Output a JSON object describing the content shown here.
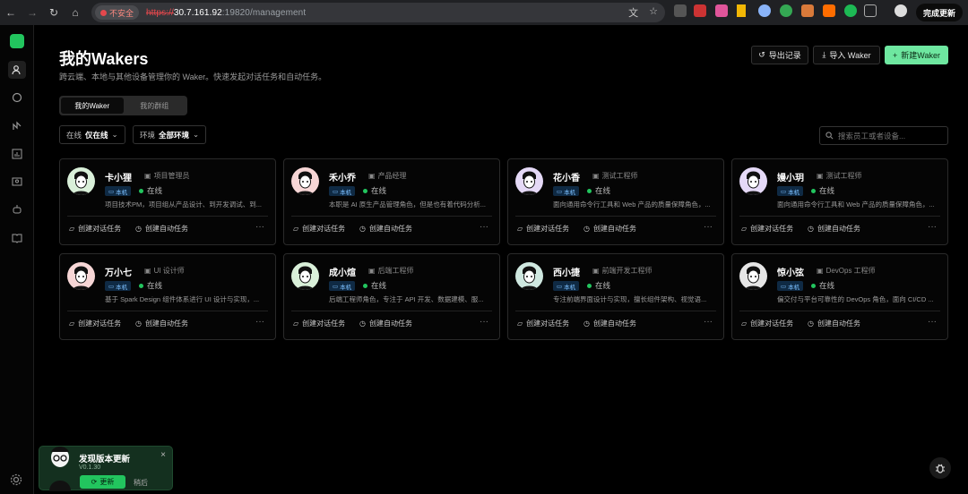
{
  "browser": {
    "security_label": "不安全",
    "url_scheme": "https://",
    "url_host": "30.7.161.92",
    "url_rest": ":19820/management",
    "update_label": "完成更新"
  },
  "header": {
    "title": "我的Wakers",
    "subtitle": "跨云端、本地与其他设备管理你的 Waker。快速发起对话任务和自动任务。",
    "export_label": "导出记录",
    "import_label": "导入 Waker",
    "new_label": "新建Waker"
  },
  "tabs": [
    "我的Waker",
    "我的群组"
  ],
  "filters": {
    "status_key": "在线",
    "status_value": "仅在线",
    "env_key": "环境",
    "env_value": "全部环境",
    "search_placeholder": "搜索员工或者设备..."
  },
  "cards": [
    {
      "name": "卡小狸",
      "role": "项目管理员",
      "badge": "本机",
      "status": "在线",
      "desc": "项目技术PM，项目组从产品设计、到开发调试、到...",
      "avatar_bg": "#d9f0d9"
    },
    {
      "name": "禾小乔",
      "role": "产品经理",
      "badge": "本机",
      "status": "在线",
      "desc": "本职是 AI 原生产品管理角色，但是也有着代码分析...",
      "avatar_bg": "#f7d6d6"
    },
    {
      "name": "花小香",
      "role": "测试工程师",
      "badge": "本机",
      "status": "在线",
      "desc": "面向通用命令行工具和 Web 产品的质量保障角色，...",
      "avatar_bg": "#e5d9f7"
    },
    {
      "name": "嫚小玥",
      "role": "测试工程师",
      "badge": "本机",
      "status": "在线",
      "desc": "面向通用命令行工具和 Web 产品的质量保障角色，...",
      "avatar_bg": "#e5d9f7"
    },
    {
      "name": "万小七",
      "role": "UI 设计师",
      "badge": "本机",
      "status": "在线",
      "desc": "基于 Spark Design 组件体系进行 UI 设计与实现，...",
      "avatar_bg": "#f7d6d6"
    },
    {
      "name": "成小煊",
      "role": "后端工程师",
      "badge": "本机",
      "status": "在线",
      "desc": "后端工程师角色，专注于 API 开发、数据建模、服...",
      "avatar_bg": "#d9f0d9"
    },
    {
      "name": "西小捷",
      "role": "前端开发工程师",
      "badge": "本机",
      "status": "在线",
      "desc": "专注前端界面设计与实现，擅长组件架构、视觉语...",
      "avatar_bg": "#cfe8e0"
    },
    {
      "name": "惊小弦",
      "role": "DevOps 工程师",
      "badge": "本机",
      "status": "在线",
      "desc": "偏交付与平台可靠性的 DevOps 角色，面向 CI/CD ...",
      "avatar_bg": "#e6e6e6"
    }
  ],
  "card_actions": {
    "chat": "创建对话任务",
    "auto": "创建自动任务",
    "more": "···"
  },
  "toast": {
    "title": "发现版本更新",
    "version": "V0.1.30",
    "update": "更新",
    "later": "稍后",
    "close": "×"
  }
}
